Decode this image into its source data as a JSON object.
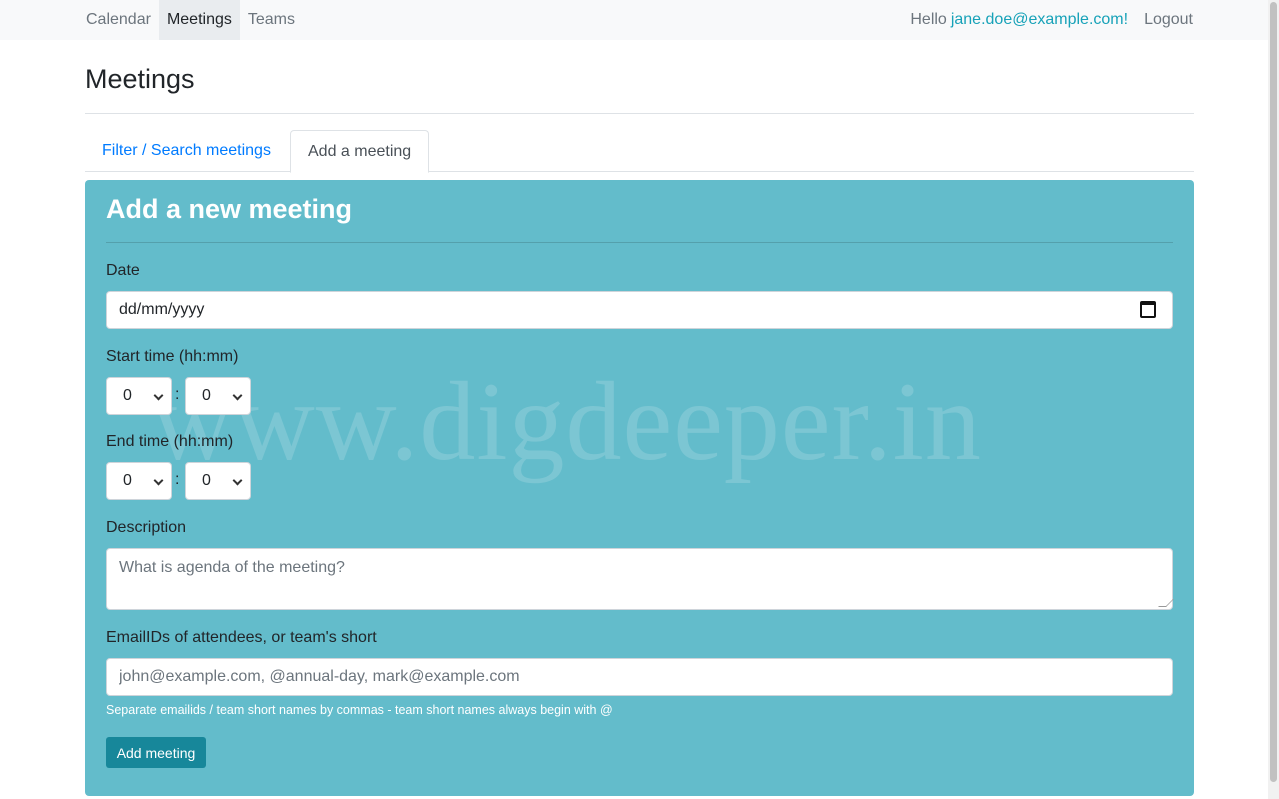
{
  "nav": {
    "items": [
      {
        "label": "Calendar",
        "active": false
      },
      {
        "label": "Meetings",
        "active": true
      },
      {
        "label": "Teams",
        "active": false
      }
    ],
    "greeting": "Hello",
    "user": "jane.doe@example.com!",
    "logout": "Logout"
  },
  "page": {
    "title": "Meetings"
  },
  "tabs": [
    {
      "label": "Filter / Search meetings",
      "active": false
    },
    {
      "label": "Add a meeting",
      "active": true
    }
  ],
  "form": {
    "title": "Add a new meeting",
    "watermark": "www.digdeeper.in",
    "date_label": "Date",
    "date_value": "dd/mm/yyyy",
    "start_label": "Start time (hh:mm)",
    "start_hour": "0",
    "start_minute": "0",
    "end_label": "End time (hh:mm)",
    "end_hour": "0",
    "end_minute": "0",
    "separator": ":",
    "description_label": "Description",
    "description_placeholder": "What is agenda of the meeting?",
    "attendees_label": "EmailIDs of attendees, or team's short",
    "attendees_placeholder": "john@example.com, @annual-day, mark@example.com",
    "help_text": "Separate emailids / team short names by commas - team short names always begin with @",
    "submit_label": "Add meeting"
  },
  "colors": {
    "card_bg": "#63bccb",
    "button_bg": "#17879a",
    "link": "#007bff",
    "user_link": "#17a2b8"
  },
  "icons": [
    "calendar-icon",
    "chevron-down-icon"
  ]
}
